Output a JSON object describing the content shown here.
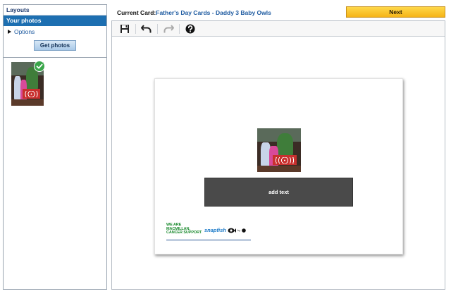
{
  "sidebar": {
    "tab_layouts": "Layouts",
    "tab_photos": "Your photos",
    "options_label": "Options",
    "get_photos_label": "Get photos"
  },
  "header": {
    "current_card_label": "Current Card:",
    "current_card_value": "Father's Day Cards - Daddy 3 Baby Owls",
    "next_label": "Next"
  },
  "toolbar": {
    "icons": [
      "save-icon",
      "undo-icon",
      "redo-icon",
      "help-icon"
    ]
  },
  "card": {
    "add_text_label": "add text",
    "logo_macmillan": [
      "WE ARE",
      "MACMILLAN.",
      "CANCER SUPPORT"
    ],
    "logo_snapfish": "snapfish",
    "logo_snapfish_by": "by"
  },
  "colors": {
    "selected_tab": "#1d6fb1",
    "next_button": "#f5b417",
    "link_blue": "#1d5aa0",
    "checkmark": "#3aa64a",
    "add_text_bg": "#4a4a4a",
    "macmillan_green": "#1a8a2e"
  }
}
